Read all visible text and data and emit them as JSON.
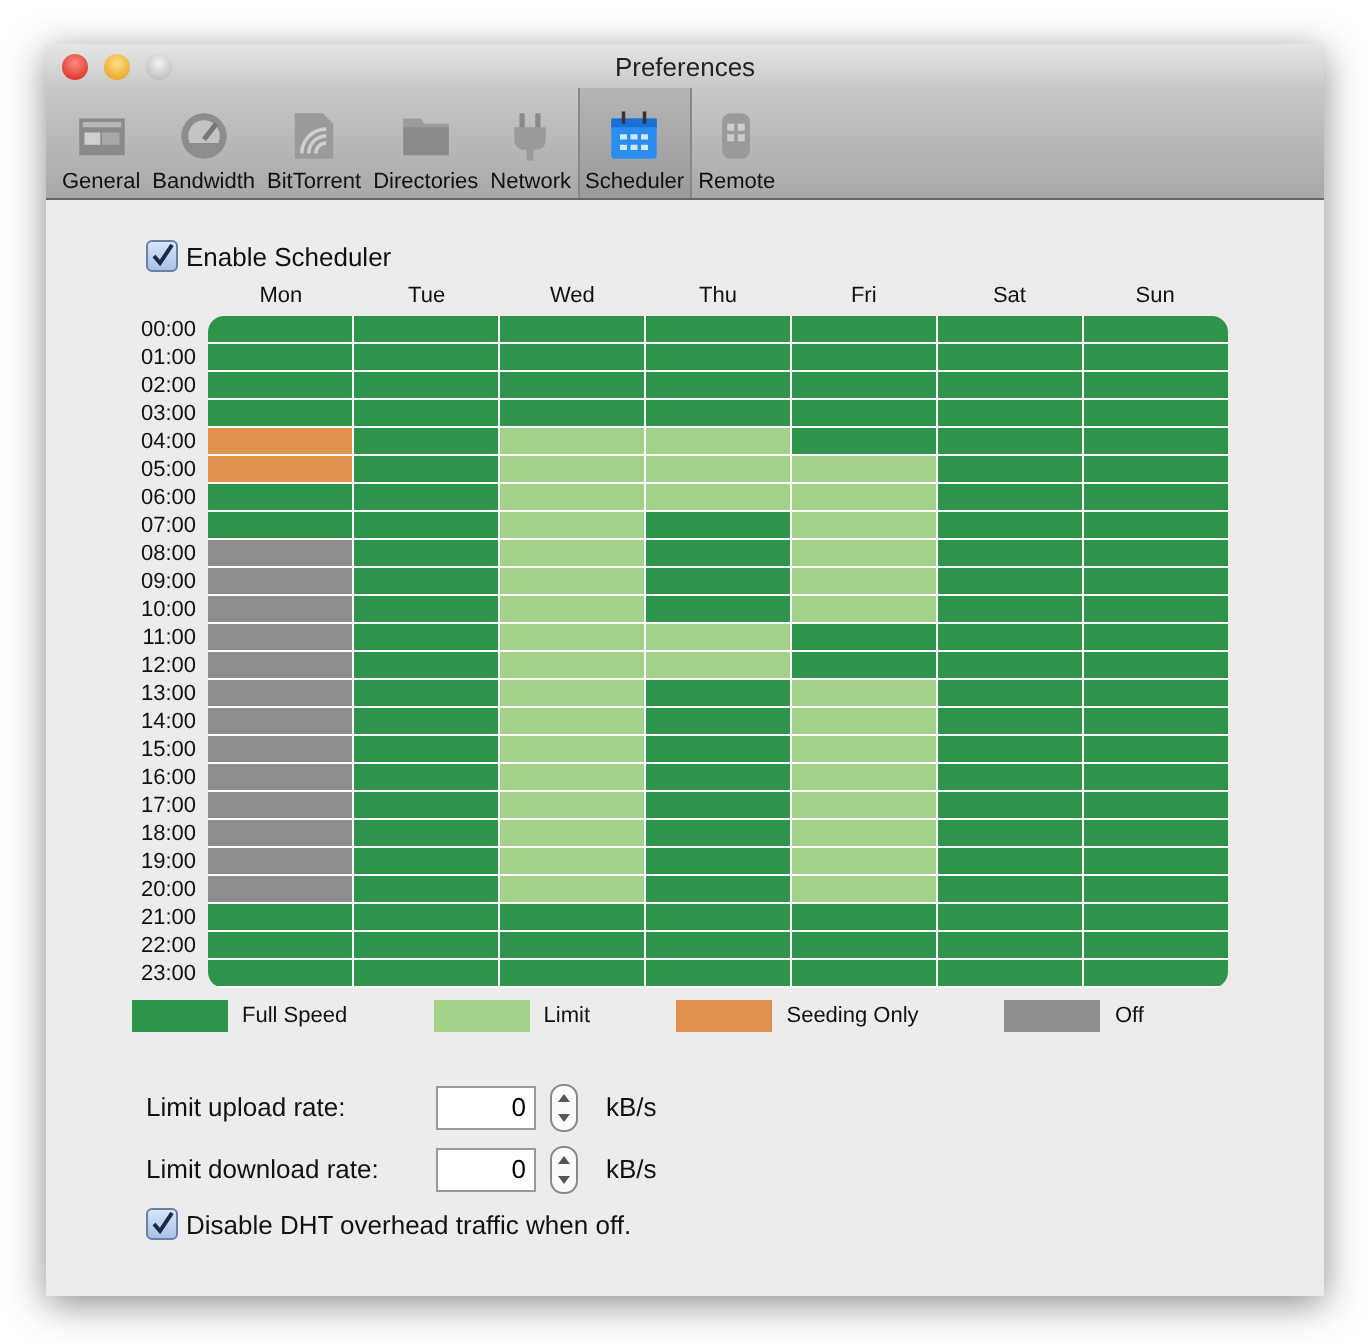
{
  "window": {
    "title": "Preferences"
  },
  "toolbar": [
    {
      "label": "General",
      "selected": false
    },
    {
      "label": "Bandwidth",
      "selected": false
    },
    {
      "label": "BitTorrent",
      "selected": false
    },
    {
      "label": "Directories",
      "selected": false
    },
    {
      "label": "Network",
      "selected": false
    },
    {
      "label": "Scheduler",
      "selected": true
    },
    {
      "label": "Remote",
      "selected": false
    }
  ],
  "enable_scheduler": {
    "label": "Enable Scheduler",
    "checked": true
  },
  "schedule": {
    "days": [
      "Mon",
      "Tue",
      "Wed",
      "Thu",
      "Fri",
      "Sat",
      "Sun"
    ],
    "rows": [
      {
        "time": "00:00",
        "cells": [
          {
            "kind": "full"
          },
          {
            "kind": "full"
          },
          {
            "kind": "full"
          },
          {
            "kind": "full"
          },
          {
            "kind": "full"
          },
          {
            "kind": "full"
          },
          {
            "kind": "full"
          }
        ]
      },
      {
        "time": "01:00",
        "cells": [
          {
            "kind": "full"
          },
          {
            "kind": "full"
          },
          {
            "kind": "full"
          },
          {
            "kind": "full"
          },
          {
            "kind": "full"
          },
          {
            "kind": "full"
          },
          {
            "kind": "full"
          }
        ]
      },
      {
        "time": "02:00",
        "cells": [
          {
            "kind": "full"
          },
          {
            "kind": "full"
          },
          {
            "kind": "full"
          },
          {
            "kind": "full"
          },
          {
            "kind": "full"
          },
          {
            "kind": "full"
          },
          {
            "kind": "full"
          }
        ]
      },
      {
        "time": "03:00",
        "cells": [
          {
            "kind": "full"
          },
          {
            "kind": "full"
          },
          {
            "kind": "full"
          },
          {
            "kind": "full"
          },
          {
            "kind": "full"
          },
          {
            "kind": "full"
          },
          {
            "kind": "full"
          }
        ]
      },
      {
        "time": "04:00",
        "cells": [
          {
            "kind": "seeding"
          },
          {
            "kind": "full"
          },
          {
            "kind": "limit"
          },
          {
            "kind": "limit"
          },
          {
            "kind": "full"
          },
          {
            "kind": "full"
          },
          {
            "kind": "full"
          }
        ]
      },
      {
        "time": "05:00",
        "cells": [
          {
            "kind": "seeding"
          },
          {
            "kind": "full"
          },
          {
            "kind": "limit"
          },
          {
            "kind": "limit"
          },
          {
            "kind": "limit"
          },
          {
            "kind": "full"
          },
          {
            "kind": "full"
          }
        ]
      },
      {
        "time": "06:00",
        "cells": [
          {
            "kind": "full"
          },
          {
            "kind": "full"
          },
          {
            "kind": "limit"
          },
          {
            "kind": "limit"
          },
          {
            "kind": "limit"
          },
          {
            "kind": "full"
          },
          {
            "kind": "full"
          }
        ]
      },
      {
        "time": "07:00",
        "cells": [
          {
            "kind": "full"
          },
          {
            "kind": "full"
          },
          {
            "kind": "limit"
          },
          {
            "kind": "full"
          },
          {
            "kind": "limit"
          },
          {
            "kind": "full"
          },
          {
            "kind": "full"
          }
        ]
      },
      {
        "time": "08:00",
        "cells": [
          {
            "kind": "off"
          },
          {
            "kind": "full"
          },
          {
            "kind": "limit"
          },
          {
            "kind": "full"
          },
          {
            "kind": "limit"
          },
          {
            "kind": "full"
          },
          {
            "kind": "full"
          }
        ]
      },
      {
        "time": "09:00",
        "cells": [
          {
            "kind": "off"
          },
          {
            "kind": "full"
          },
          {
            "kind": "limit"
          },
          {
            "kind": "full"
          },
          {
            "kind": "limit"
          },
          {
            "kind": "full"
          },
          {
            "kind": "full"
          }
        ]
      },
      {
        "time": "10:00",
        "cells": [
          {
            "kind": "off"
          },
          {
            "kind": "full"
          },
          {
            "kind": "limit"
          },
          {
            "kind": "full"
          },
          {
            "kind": "limit"
          },
          {
            "kind": "full"
          },
          {
            "kind": "full"
          }
        ]
      },
      {
        "time": "11:00",
        "cells": [
          {
            "kind": "off"
          },
          {
            "kind": "full"
          },
          {
            "kind": "limit"
          },
          {
            "kind": "limit"
          },
          {
            "kind": "full"
          },
          {
            "kind": "full"
          },
          {
            "kind": "full"
          }
        ]
      },
      {
        "time": "12:00",
        "cells": [
          {
            "kind": "off"
          },
          {
            "kind": "full"
          },
          {
            "kind": "limit"
          },
          {
            "kind": "limit"
          },
          {
            "kind": "full"
          },
          {
            "kind": "full"
          },
          {
            "kind": "full"
          }
        ]
      },
      {
        "time": "13:00",
        "cells": [
          {
            "kind": "off"
          },
          {
            "kind": "full"
          },
          {
            "kind": "limit"
          },
          {
            "kind": "full"
          },
          {
            "kind": "limit"
          },
          {
            "kind": "full"
          },
          {
            "kind": "full"
          }
        ]
      },
      {
        "time": "14:00",
        "cells": [
          {
            "kind": "off"
          },
          {
            "kind": "full"
          },
          {
            "kind": "limit"
          },
          {
            "kind": "full"
          },
          {
            "kind": "limit"
          },
          {
            "kind": "full"
          },
          {
            "kind": "full"
          }
        ]
      },
      {
        "time": "15:00",
        "cells": [
          {
            "kind": "off"
          },
          {
            "kind": "full"
          },
          {
            "kind": "limit"
          },
          {
            "kind": "full"
          },
          {
            "kind": "limit"
          },
          {
            "kind": "full"
          },
          {
            "kind": "full"
          }
        ]
      },
      {
        "time": "16:00",
        "cells": [
          {
            "kind": "off"
          },
          {
            "kind": "full"
          },
          {
            "kind": "limit"
          },
          {
            "kind": "full"
          },
          {
            "kind": "limit"
          },
          {
            "kind": "full"
          },
          {
            "kind": "full"
          }
        ]
      },
      {
        "time": "17:00",
        "cells": [
          {
            "kind": "off"
          },
          {
            "kind": "full"
          },
          {
            "kind": "limit"
          },
          {
            "kind": "full"
          },
          {
            "kind": "limit"
          },
          {
            "kind": "full"
          },
          {
            "kind": "full"
          }
        ]
      },
      {
        "time": "18:00",
        "cells": [
          {
            "kind": "off"
          },
          {
            "kind": "full"
          },
          {
            "kind": "limit"
          },
          {
            "kind": "full"
          },
          {
            "kind": "limit"
          },
          {
            "kind": "full"
          },
          {
            "kind": "full"
          }
        ]
      },
      {
        "time": "19:00",
        "cells": [
          {
            "kind": "off"
          },
          {
            "kind": "full"
          },
          {
            "kind": "limit"
          },
          {
            "kind": "full"
          },
          {
            "kind": "limit"
          },
          {
            "kind": "full"
          },
          {
            "kind": "full"
          }
        ]
      },
      {
        "time": "20:00",
        "cells": [
          {
            "kind": "off"
          },
          {
            "kind": "full"
          },
          {
            "kind": "limit"
          },
          {
            "kind": "full"
          },
          {
            "kind": "limit"
          },
          {
            "kind": "full"
          },
          {
            "kind": "full"
          }
        ]
      },
      {
        "time": "21:00",
        "cells": [
          {
            "kind": "full"
          },
          {
            "kind": "full"
          },
          {
            "kind": "full"
          },
          {
            "kind": "full"
          },
          {
            "kind": "full"
          },
          {
            "kind": "full"
          },
          {
            "kind": "full"
          }
        ]
      },
      {
        "time": "22:00",
        "cells": [
          {
            "kind": "full"
          },
          {
            "kind": "full"
          },
          {
            "kind": "full"
          },
          {
            "kind": "full"
          },
          {
            "kind": "full"
          },
          {
            "kind": "full"
          },
          {
            "kind": "full"
          }
        ]
      },
      {
        "time": "23:00",
        "cells": [
          {
            "kind": "full"
          },
          {
            "kind": "full"
          },
          {
            "kind": "full"
          },
          {
            "kind": "full"
          },
          {
            "kind": "full"
          },
          {
            "kind": "full"
          },
          {
            "kind": "full"
          }
        ]
      }
    ]
  },
  "legend": [
    {
      "kind": "full",
      "label": "Full Speed",
      "color": "#2e944a"
    },
    {
      "kind": "limit",
      "label": "Limit",
      "color": "#a2d28a"
    },
    {
      "kind": "seeding",
      "label": "Seeding Only",
      "color": "#e1914e"
    },
    {
      "kind": "off",
      "label": "Off",
      "color": "#8e8e8c"
    }
  ],
  "rates": [
    {
      "label": "Limit upload rate:",
      "value": "0",
      "unit": "kB/s"
    },
    {
      "label": "Limit download rate:",
      "value": "0",
      "unit": "kB/s"
    }
  ],
  "disable_dht": {
    "label": "Disable DHT overhead traffic when off.",
    "checked": true
  }
}
